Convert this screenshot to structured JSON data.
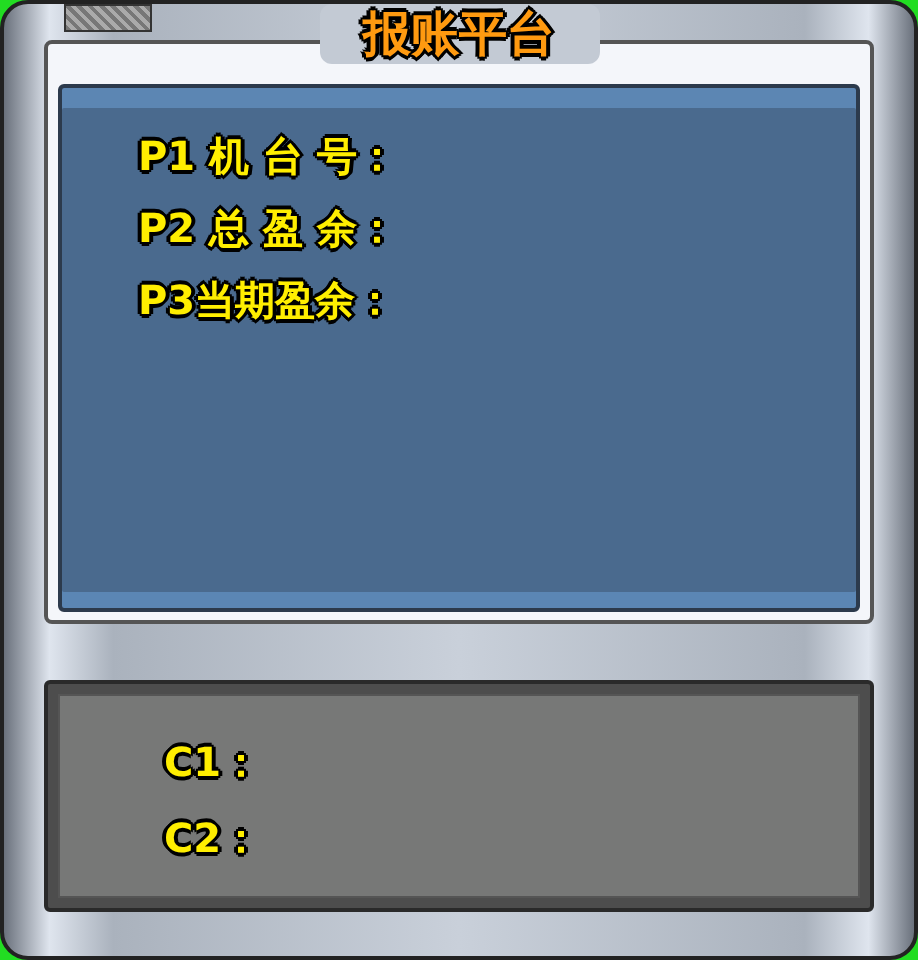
{
  "title": "报账平台",
  "upper_panel": {
    "lines": [
      "P1 机 台 号：",
      "P2 总 盈 余：",
      "P3当期盈余："
    ]
  },
  "lower_panel": {
    "lines": [
      "C1：",
      "C2："
    ]
  }
}
